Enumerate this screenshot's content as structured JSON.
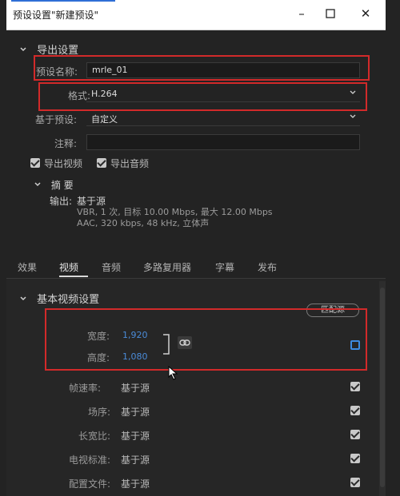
{
  "window": {
    "title": "预设设置\"新建预设\""
  },
  "export_settings": {
    "header": "导出设置",
    "preset_name_label": "预设名称:",
    "preset_name_value": "mrle_01",
    "format_label": "格式:",
    "format_value": "H.264",
    "based_on_label": "基于预设:",
    "based_on_value": "自定义",
    "comment_label": "注释:",
    "comment_value": "",
    "export_video_label": "导出视频",
    "export_audio_label": "导出音频"
  },
  "summary": {
    "header": "摘 要",
    "output_label": "输出:",
    "output_value": "基于源",
    "line1": "VBR, 1 次, 目标 10.00 Mbps, 最大 12.00 Mbps",
    "line2": "AAC, 320 kbps, 48 kHz, 立体声"
  },
  "tabs": [
    {
      "label": "效果"
    },
    {
      "label": "视频"
    },
    {
      "label": "音频"
    },
    {
      "label": "多路复用器"
    },
    {
      "label": "字幕"
    },
    {
      "label": "发布"
    }
  ],
  "basic_video": {
    "header": "基本视频设置",
    "match_source_label": "匹配源",
    "width_label": "宽度:",
    "width_value": "1,920",
    "height_label": "高度:",
    "height_value": "1,080",
    "rows": [
      {
        "label": "帧速率:",
        "value": "基于源"
      },
      {
        "label": "场序:",
        "value": "基于源"
      },
      {
        "label": "长宽比:",
        "value": "基于源"
      },
      {
        "label": "电视标准:",
        "value": "基于源"
      },
      {
        "label": "配置文件:",
        "value": "基于源"
      }
    ]
  },
  "colors": {
    "highlight_red": "#d22a2a",
    "value_blue": "#4a8bd8",
    "panel_bg": "#232323"
  }
}
